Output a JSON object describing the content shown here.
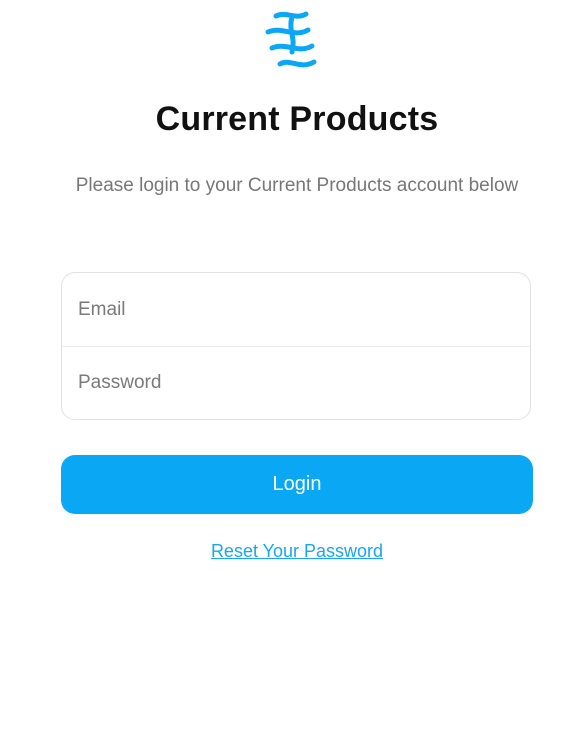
{
  "app": {
    "logo_icon": "current-waves-logo",
    "title": "Current Products",
    "subtitle": "Please login to your Current Products account below"
  },
  "form": {
    "email_placeholder": "Email",
    "email_value": "",
    "password_placeholder": "Password",
    "password_value": "",
    "login_label": "Login",
    "reset_label": "Reset Your Password"
  },
  "colors": {
    "accent": "#0aa7f5",
    "link": "#1aa6ee",
    "title": "#111111",
    "subtitle": "#777777"
  }
}
